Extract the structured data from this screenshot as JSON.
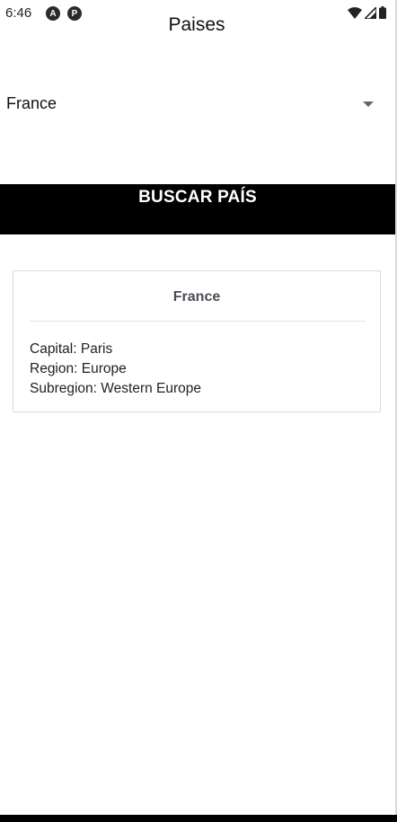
{
  "status_bar": {
    "time": "6:46",
    "icon_a": "A",
    "icon_b": "P"
  },
  "app": {
    "title": "Paises"
  },
  "picker": {
    "selected": "France"
  },
  "search_button": {
    "label": "BUSCAR PAÍS"
  },
  "country_card": {
    "name": "France",
    "capital_label": "Capital:",
    "capital": "Paris",
    "region_label": "Region:",
    "region": "Europe",
    "subregion_label": "Subregion:",
    "subregion": "Western Europe"
  },
  "icons": [
    "wifi-icon",
    "signal-icon",
    "battery-icon",
    "dropdown-caret-icon"
  ]
}
